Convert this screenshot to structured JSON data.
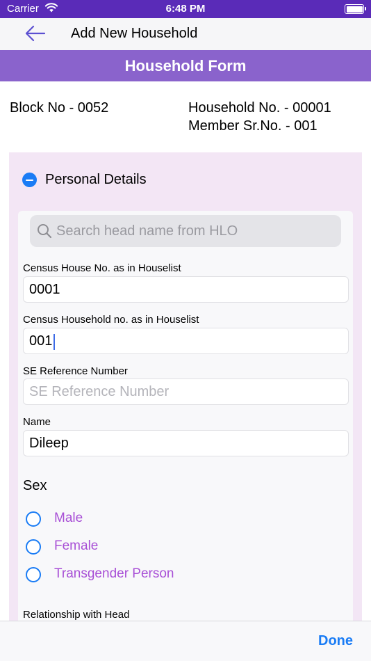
{
  "status_bar": {
    "carrier": "Carrier",
    "time": "6:48 PM"
  },
  "nav": {
    "title": "Add New Household",
    "back_icon": "arrow-left-icon"
  },
  "form": {
    "header": "Household Form",
    "block_no": "Block No - 0052",
    "household_no": "Household No. - 00001",
    "member_sr_no": "Member Sr.No. - 001"
  },
  "section": {
    "title": "Personal Details",
    "toggle_icon": "minus-circle-icon",
    "search_placeholder": "Search head name from HLO",
    "fields": [
      {
        "label": "Census House No. as in Houselist",
        "value": "0001",
        "placeholder": ""
      },
      {
        "label": "Census Household no. as in Houselist",
        "value": "001",
        "placeholder": ""
      },
      {
        "label": "SE Reference Number",
        "value": "",
        "placeholder": "SE Reference Number"
      },
      {
        "label": "Name",
        "value": "Dileep",
        "placeholder": ""
      }
    ],
    "sex": {
      "label": "Sex",
      "options": [
        "Male",
        "Female",
        "Transgender Person"
      ]
    },
    "relationship_label": "Relationship with Head"
  },
  "toolbar": {
    "done_label": "Done"
  },
  "colors": {
    "status_bar": "#5a2bb8",
    "form_header": "#8a63cc",
    "section_bg": "#f3e6f5",
    "accent_blue": "#1a7cf5",
    "option_text": "#a84fd6"
  }
}
